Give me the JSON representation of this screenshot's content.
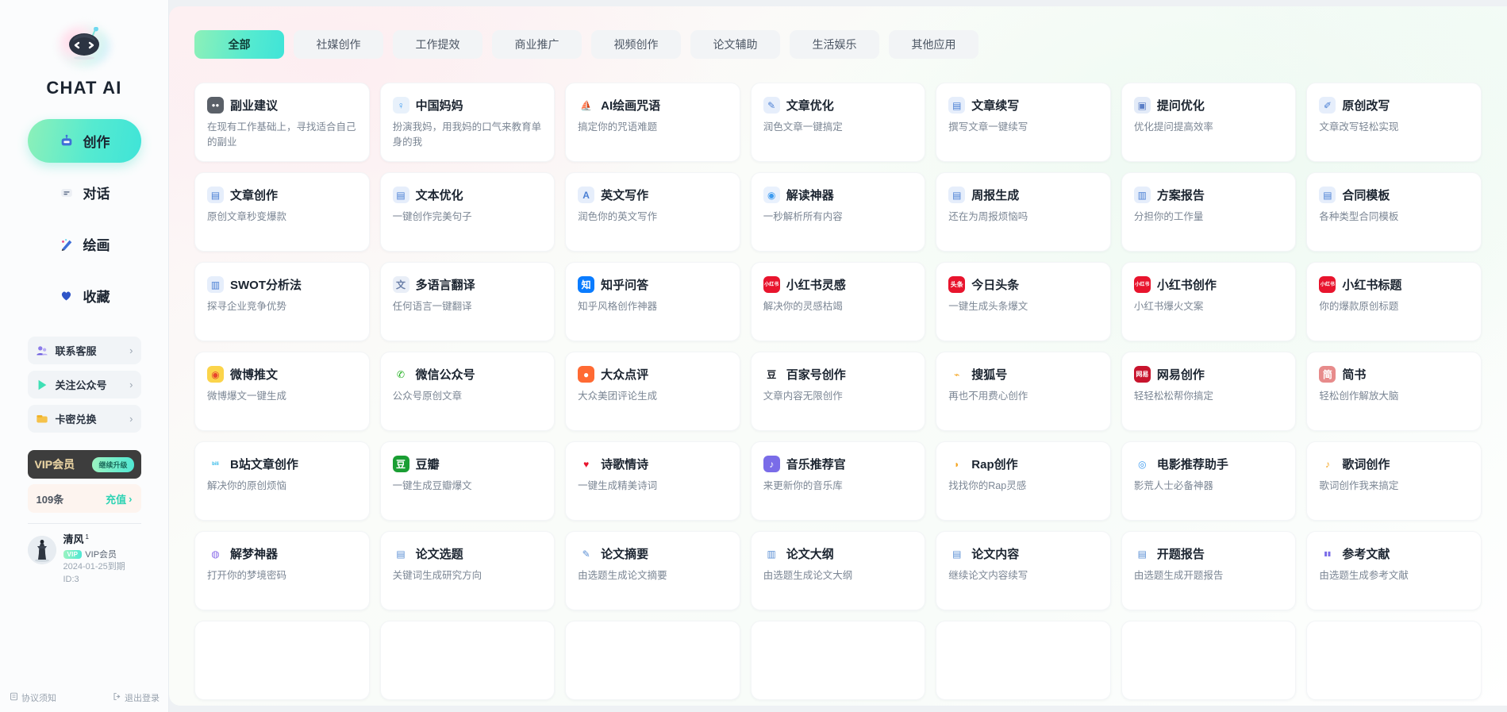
{
  "brand": {
    "title": "CHAT AI",
    "logo_icon": "robot-logo-icon"
  },
  "sidebar": {
    "nav": [
      {
        "label": "创作",
        "icon": "robot-icon",
        "active": true
      },
      {
        "label": "对话",
        "icon": "chat-icon",
        "active": false
      },
      {
        "label": "绘画",
        "icon": "paint-brush-icon",
        "active": false
      },
      {
        "label": "收藏",
        "icon": "heart-icon",
        "active": false
      }
    ],
    "links": [
      {
        "label": "联系客服",
        "icon": "customer-service-icon",
        "chevron": "›"
      },
      {
        "label": "关注公众号",
        "icon": "play-icon",
        "chevron": "›"
      },
      {
        "label": "卡密兑换",
        "icon": "card-icon",
        "chevron": "›"
      }
    ],
    "vip": {
      "label": "VIP会员",
      "button": "继续升级"
    },
    "quota": {
      "count": "109条",
      "action": "充值",
      "chevron": "›"
    },
    "profile": {
      "name": "清风",
      "level": "1",
      "chip": "VIP",
      "member_text": "VIP会员",
      "expiry": "2024-01-25到期",
      "id": "ID:3"
    },
    "footer": [
      {
        "label": "协议须知",
        "icon": "document-icon"
      },
      {
        "label": "退出登录",
        "icon": "logout-icon"
      }
    ]
  },
  "tabs": [
    {
      "label": "全部",
      "active": true
    },
    {
      "label": "社媒创作",
      "active": false
    },
    {
      "label": "工作提效",
      "active": false
    },
    {
      "label": "商业推广",
      "active": false
    },
    {
      "label": "视频创作",
      "active": false
    },
    {
      "label": "论文辅助",
      "active": false
    },
    {
      "label": "生活娱乐",
      "active": false
    },
    {
      "label": "其他应用",
      "active": false
    }
  ],
  "cards": [
    {
      "title": "副业建议",
      "desc": "在现有工作基础上，寻找适合自己的副业",
      "icon": "panda-icon",
      "glyph": "●●",
      "bg": "#5a6068",
      "fg": "#ffffff"
    },
    {
      "title": "中国妈妈",
      "desc": "扮演我妈，用我妈的口气来教育单身的我",
      "icon": "person-icon",
      "glyph": "♀",
      "bg": "#e8f1fb",
      "fg": "#3d9bf0"
    },
    {
      "title": "AI绘画咒语",
      "desc": "搞定你的咒语难题",
      "icon": "sailboat-icon",
      "glyph": "⛵",
      "bg": "#ffffff",
      "fg": "#6b7480"
    },
    {
      "title": "文章优化",
      "desc": "润色文章一键搞定",
      "icon": "edit-document-icon",
      "glyph": "✎",
      "bg": "#e6eefb",
      "fg": "#4a7fd4"
    },
    {
      "title": "文章续写",
      "desc": "撰写文章一键续写",
      "icon": "document-check-icon",
      "glyph": "▤",
      "bg": "#e6eefb",
      "fg": "#4a7fd4"
    },
    {
      "title": "提问优化",
      "desc": "优化提问提高效率",
      "icon": "question-document-icon",
      "glyph": "▣",
      "bg": "#e3ebf8",
      "fg": "#5b7fc7"
    },
    {
      "title": "原创改写",
      "desc": "文章改写轻松实现",
      "icon": "rewrite-icon",
      "glyph": "✐",
      "bg": "#e6eefb",
      "fg": "#4a7fd4"
    },
    {
      "title": "文章创作",
      "desc": "原创文章秒变爆款",
      "icon": "article-icon",
      "glyph": "▤",
      "bg": "#e6eefb",
      "fg": "#4a7fd4"
    },
    {
      "title": "文本优化",
      "desc": "一键创作完美句子",
      "icon": "text-optimize-icon",
      "glyph": "▤",
      "bg": "#e6eefb",
      "fg": "#4a7fd4"
    },
    {
      "title": "英文写作",
      "desc": "润色你的英文写作",
      "icon": "letter-a-icon",
      "glyph": "A",
      "bg": "#e6eefb",
      "fg": "#4a7fd4"
    },
    {
      "title": "解读神器",
      "desc": "一秒解析所有内容",
      "icon": "lamp-icon",
      "glyph": "◉",
      "bg": "#e9f1fd",
      "fg": "#3d9bf0"
    },
    {
      "title": "周报生成",
      "desc": "还在为周报烦恼吗",
      "icon": "report-icon",
      "glyph": "▤",
      "bg": "#e6eefb",
      "fg": "#4a7fd4"
    },
    {
      "title": "方案报告",
      "desc": "分担你的工作量",
      "icon": "plan-report-icon",
      "glyph": "▥",
      "bg": "#e6eefb",
      "fg": "#4a7fd4"
    },
    {
      "title": "合同模板",
      "desc": "各种类型合同模板",
      "icon": "contract-icon",
      "glyph": "▤",
      "bg": "#e6eefb",
      "fg": "#4a7fd4"
    },
    {
      "title": "SWOT分析法",
      "desc": "探寻企业竞争优势",
      "icon": "analysis-icon",
      "glyph": "▥",
      "bg": "#e6eefb",
      "fg": "#4a7fd4"
    },
    {
      "title": "多语言翻译",
      "desc": "任何语言一键翻译",
      "icon": "translate-icon",
      "glyph": "文",
      "bg": "#e9eef7",
      "fg": "#6b7fa8"
    },
    {
      "title": "知乎问答",
      "desc": "知乎风格创作神器",
      "icon": "zhihu-icon",
      "glyph": "知",
      "bg": "#0a7cff",
      "fg": "#ffffff"
    },
    {
      "title": "小红书灵感",
      "desc": "解决你的灵感枯竭",
      "icon": "xiaohongshu-icon",
      "glyph": "小红书",
      "bg": "#e8142d",
      "fg": "#ffffff"
    },
    {
      "title": "今日头条",
      "desc": "一键生成头条爆文",
      "icon": "toutiao-icon",
      "glyph": "头条",
      "bg": "#e8142d",
      "fg": "#ffffff"
    },
    {
      "title": "小红书创作",
      "desc": "小红书爆火文案",
      "icon": "xiaohongshu-icon",
      "glyph": "小红书",
      "bg": "#e8142d",
      "fg": "#ffffff"
    },
    {
      "title": "小红书标题",
      "desc": "你的爆款原创标题",
      "icon": "xiaohongshu-icon",
      "glyph": "小红书",
      "bg": "#e8142d",
      "fg": "#ffffff"
    },
    {
      "title": "微博推文",
      "desc": "微博爆文一键生成",
      "icon": "weibo-icon",
      "glyph": "◉",
      "bg": "#fbd44a",
      "fg": "#e8442d"
    },
    {
      "title": "微信公众号",
      "desc": "公众号原创文章",
      "icon": "wechat-icon",
      "glyph": "✆",
      "bg": "#ffffff",
      "fg": "#1aad19"
    },
    {
      "title": "大众点评",
      "desc": "大众美团评论生成",
      "icon": "dianping-icon",
      "glyph": "●",
      "bg": "#ff6a33",
      "fg": "#ffffff"
    },
    {
      "title": "百家号创作",
      "desc": "文章内容无限创作",
      "icon": "baijiahao-icon",
      "glyph": "豆",
      "bg": "#ffffff",
      "fg": "#222831"
    },
    {
      "title": "搜狐号",
      "desc": "再也不用费心创作",
      "icon": "sohu-icon",
      "glyph": "⌁",
      "bg": "#ffffff",
      "fg": "#f5a623"
    },
    {
      "title": "网易创作",
      "desc": "轻轻松松帮你搞定",
      "icon": "netease-icon",
      "glyph": "网易",
      "bg": "#c8142d",
      "fg": "#ffffff"
    },
    {
      "title": "简书",
      "desc": "轻松创作解放大脑",
      "icon": "jianshu-icon",
      "glyph": "简",
      "bg": "#e78b8b",
      "fg": "#ffffff"
    },
    {
      "title": "B站文章创作",
      "desc": "解决你的原创烦恼",
      "icon": "bilibili-icon",
      "glyph": "bili",
      "bg": "#ffffff",
      "fg": "#2bb7e8"
    },
    {
      "title": "豆瓣",
      "desc": "一键生成豆瓣爆文",
      "icon": "douban-icon",
      "glyph": "豆",
      "bg": "#1a9e33",
      "fg": "#ffffff"
    },
    {
      "title": "诗歌情诗",
      "desc": "一键生成精美诗词",
      "icon": "heart-icon",
      "glyph": "♥",
      "bg": "#ffffff",
      "fg": "#e8142d"
    },
    {
      "title": "音乐推荐官",
      "desc": "来更新你的音乐库",
      "icon": "music-icon",
      "glyph": "♪",
      "bg": "#7a6ce8",
      "fg": "#ffffff"
    },
    {
      "title": "Rap创作",
      "desc": "找找你的Rap灵感",
      "icon": "speaker-icon",
      "glyph": "◗",
      "bg": "#ffffff",
      "fg": "#f5a623"
    },
    {
      "title": "电影推荐助手",
      "desc": "影荒人士必备神器",
      "icon": "film-reel-icon",
      "glyph": "◎",
      "bg": "#ffffff",
      "fg": "#3d9bf0"
    },
    {
      "title": "歌词创作",
      "desc": "歌词创作我来搞定",
      "icon": "lyrics-icon",
      "glyph": "♪",
      "bg": "#ffffff",
      "fg": "#f5a623"
    },
    {
      "title": "解梦神器",
      "desc": "打开你的梦境密码",
      "icon": "dream-icon",
      "glyph": "◍",
      "bg": "#ffffff",
      "fg": "#8a6ce8"
    },
    {
      "title": "论文选题",
      "desc": "关键词生成研究方向",
      "icon": "paper-topic-icon",
      "glyph": "▤",
      "bg": "#ffffff",
      "fg": "#5b8fd4"
    },
    {
      "title": "论文摘要",
      "desc": "由选题生成论文摘要",
      "icon": "paper-abstract-icon",
      "glyph": "✎",
      "bg": "#ffffff",
      "fg": "#5b8fd4"
    },
    {
      "title": "论文大纲",
      "desc": "由选题生成论文大纲",
      "icon": "paper-outline-icon",
      "glyph": "▥",
      "bg": "#ffffff",
      "fg": "#5b8fd4"
    },
    {
      "title": "论文内容",
      "desc": "继续论文内容续写",
      "icon": "paper-content-icon",
      "glyph": "▤",
      "bg": "#ffffff",
      "fg": "#5b8fd4"
    },
    {
      "title": "开题报告",
      "desc": "由选题生成开题报告",
      "icon": "proposal-icon",
      "glyph": "▤",
      "bg": "#ffffff",
      "fg": "#5b8fd4"
    },
    {
      "title": "参考文献",
      "desc": "由选题生成参考文献",
      "icon": "reference-icon",
      "glyph": "▮▮",
      "bg": "#ffffff",
      "fg": "#7a6ce8"
    }
  ],
  "partial_row_count": 7
}
